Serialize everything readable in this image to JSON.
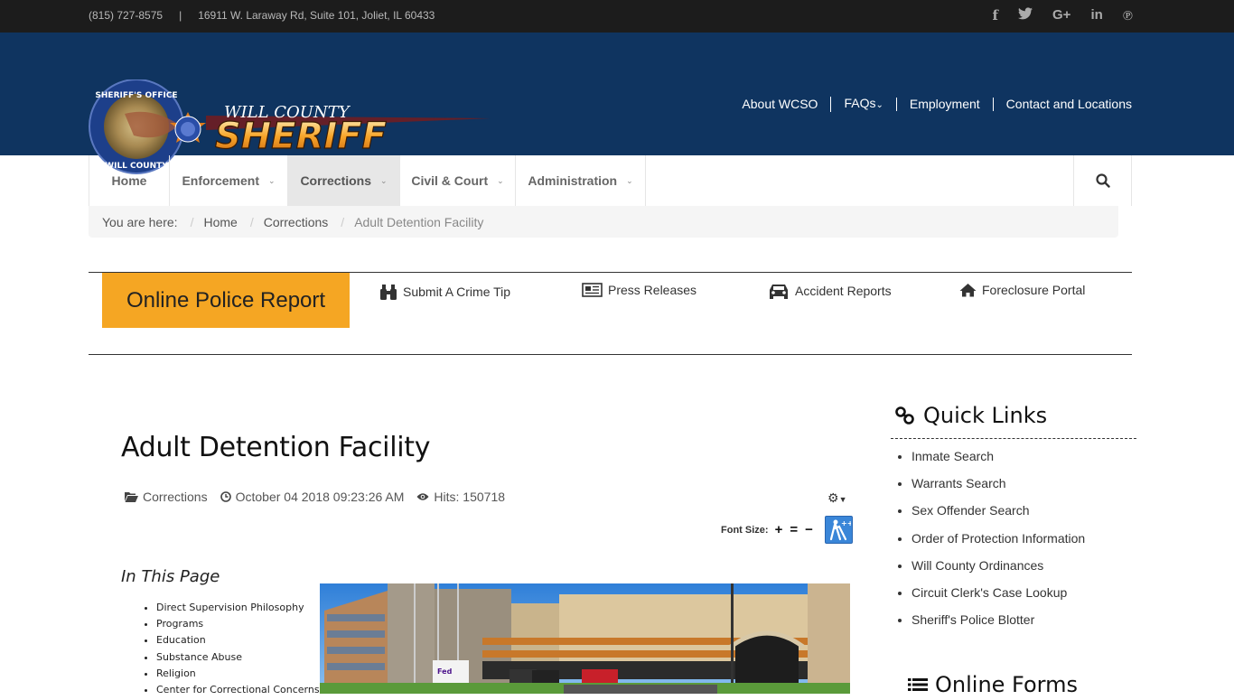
{
  "topbar": {
    "phone": "(815) 727-8575",
    "separator": "|",
    "address": "16911 W. Laraway Rd, Suite 101, Joliet, IL 60433",
    "social": [
      {
        "name": "facebook-icon",
        "glyph": "f"
      },
      {
        "name": "twitter-icon",
        "glyph": "🐦"
      },
      {
        "name": "google-plus-icon",
        "glyph": "G+"
      },
      {
        "name": "linkedin-icon",
        "glyph": "in"
      },
      {
        "name": "pinterest-icon",
        "glyph": "P"
      }
    ]
  },
  "header": {
    "logo": {
      "seal_top_text": "SHERIFF'S OFFICE",
      "seal_bottom_text": "WILL COUNTY",
      "line1": "WILL COUNTY",
      "line2": "SHERIFF"
    },
    "nav": [
      {
        "label": "About WCSO"
      },
      {
        "label": "FAQs",
        "has_dropdown": true
      },
      {
        "label": "Employment"
      },
      {
        "label": "Contact and Locations"
      }
    ]
  },
  "mainnav": {
    "items": [
      {
        "label": "Home",
        "dropdown": false,
        "active": false
      },
      {
        "label": "Enforcement",
        "dropdown": true,
        "active": false
      },
      {
        "label": "Corrections",
        "dropdown": true,
        "active": true
      },
      {
        "label": "Civil & Court",
        "dropdown": true,
        "active": false
      },
      {
        "label": "Administration",
        "dropdown": true,
        "active": false
      }
    ],
    "search_icon": "search-icon"
  },
  "breadcrumb": {
    "prefix": "You are here:",
    "items": [
      "Home",
      "Corrections"
    ],
    "current": "Adult Detention Facility"
  },
  "quickstrip": {
    "primary_button": "Online Police Report",
    "primary_color": "#f5a623",
    "links": [
      {
        "label": "Submit A Crime Tip",
        "icon": "binoculars-icon"
      },
      {
        "label": "Press Releases",
        "icon": "newspaper-icon"
      },
      {
        "label": "Accident Reports",
        "icon": "car-icon"
      },
      {
        "label": "Foreclosure Portal",
        "icon": "home-icon"
      }
    ]
  },
  "article": {
    "title": "Adult Detention Facility",
    "category": "Corrections",
    "date": "October 04 2018 09:23:26 AM",
    "hits": "Hits: 150718",
    "font_size_label": "Font Size:",
    "font_controls": [
      "+",
      "=",
      "−"
    ],
    "in_this_page_title": "In This Page",
    "in_this_page": [
      "Direct Supervision Philosophy",
      "Programs",
      "Education",
      "Substance Abuse",
      "Religion",
      "Center for Correctional Concerns"
    ]
  },
  "sidebar": {
    "quick_links_title": "Quick Links",
    "quick_links": [
      "Inmate Search",
      "Warrants Search",
      "Sex Offender Search",
      "Order of Protection Information",
      "Will County Ordinances",
      "Circuit Clerk's Case Lookup",
      "Sheriff's Police Blotter"
    ],
    "online_forms_title": "Online Forms"
  }
}
